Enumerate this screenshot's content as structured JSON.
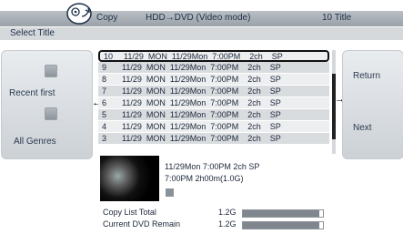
{
  "header": {
    "mode_label": "Copy",
    "path_label": "HDD→DVD (Video mode)",
    "title_count": "10 Title",
    "subtitle": "Select Title"
  },
  "left_panel": {
    "recent_first": "Recent first",
    "all_genres": "All Genres"
  },
  "right_panel": {
    "return_label": "Return",
    "next_label": "Next"
  },
  "titles": [
    {
      "no": "10",
      "text": "11/29  MON  11/29Mon  7:00PM    2ch    SP"
    },
    {
      "no": "9",
      "text": "11/29  MON  11/29Mon  7:00PM    2ch    SP"
    },
    {
      "no": "8",
      "text": "11/29  MON  11/29Mon  7:00PM    2ch    SP"
    },
    {
      "no": "7",
      "text": "11/29  MON  11/29Mon  7:00PM    2ch    SP"
    },
    {
      "no": "6",
      "text": "11/29  MON  11/29Mon  7:00PM    2ch    SP"
    },
    {
      "no": "5",
      "text": "11/29  MON  11/29Mon  7:00PM    2ch    SP"
    },
    {
      "no": "4",
      "text": "11/29  MON  11/29Mon  7:00PM    2ch    SP"
    },
    {
      "no": "3",
      "text": "11/29  MON  11/29Mon  7:00PM    2ch    SP"
    }
  ],
  "preview": {
    "line1": "11/29Mon  7:00PM   2ch    SP",
    "line2": "7:00PM      2h00m(1.0G)"
  },
  "totals": {
    "copy_list_label": "Copy List Total",
    "copy_list_value": "1.2G",
    "copy_list_fill": 0.95,
    "remain_label": "Current DVD Remain",
    "remain_value": "1.2G",
    "remain_fill": 0.95
  },
  "icons": {
    "disc": "disc-copy-icon",
    "recent": "recent-first-icon",
    "genres": "all-genres-icon"
  }
}
